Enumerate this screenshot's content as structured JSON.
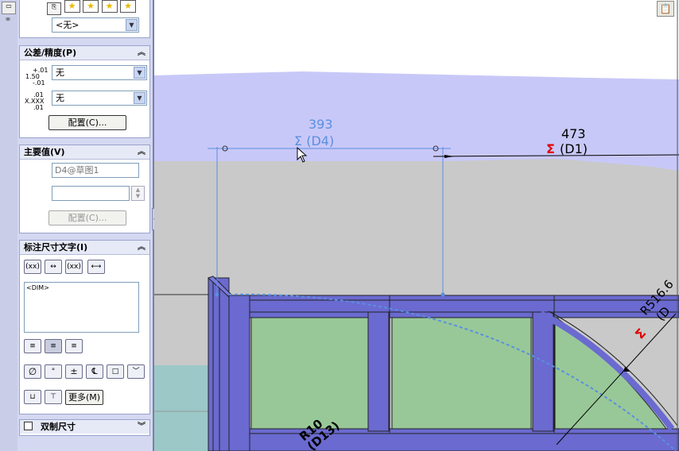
{
  "panel": {
    "top_select": "<无>",
    "tolerance": {
      "title": "公差/精度(P)",
      "tolerance_icon_lines": [
        "+.01",
        "1.50",
        "-.01"
      ],
      "tolerance_value": "无",
      "precision_icon_lines": [
        ".01",
        "X.XXX",
        ".01"
      ],
      "precision_value": "无",
      "config_button": "配置(C)..."
    },
    "primary": {
      "title": "主要值(V)",
      "name_value": "D4@草图1",
      "value_input": "",
      "config_button": "配置(C)..."
    },
    "dimtext": {
      "title": "标注尺寸文字(I)",
      "text_content": "<DIM>",
      "more_button": "更多(M)"
    },
    "dual": {
      "title": "双制尺寸"
    }
  },
  "canvas": {
    "dim_d4_value": "393",
    "dim_d4_label": "Σ (D4)",
    "dim_d1_value": "473",
    "dim_d1_sigma": "Σ",
    "dim_d1_label": "(D1)",
    "dim_r516_label": "R516.6",
    "dim_r516_paren": "(D",
    "dim_r10_label": "R10",
    "dim_r10_paren": "(D13)",
    "sigma_red": "Σ"
  },
  "colors": {
    "accent_blue": "#5b8fe0",
    "frame_purple": "#6a6ad0",
    "glass_green": "#98c898",
    "sky_lavender": "#c8c8f8",
    "ground_gray": "#c8c8c8",
    "sigma_red": "#e00000"
  }
}
